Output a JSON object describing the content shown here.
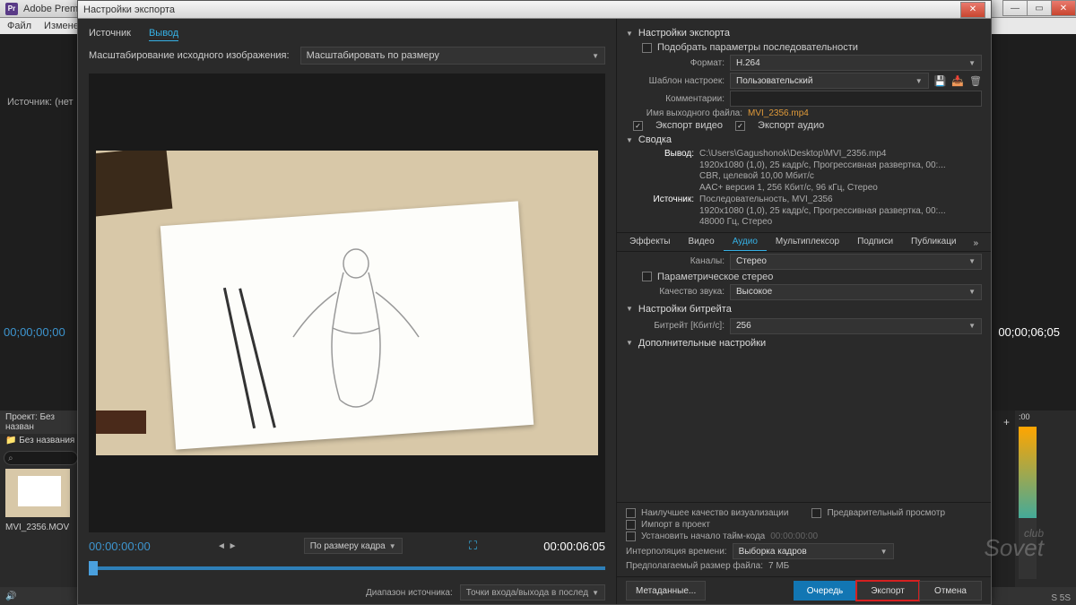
{
  "bg": {
    "app_title": "Adobe Premie",
    "menu": {
      "file": "Файл",
      "edit": "Измене"
    },
    "source_label": "Источник: (нет",
    "tc_left": "00;00;00;00",
    "tc_right": "00;00;06;05",
    "project_label": "Проект: Без назван",
    "bin_label": "Без названия",
    "clip_label": "MVI_2356.MOV",
    "speaker_icon": "🔊",
    "right_tc": ":00",
    "audio_scale": "S  5S",
    "plus": "+"
  },
  "dialog": {
    "title": "Настройки экспорта",
    "tabs": {
      "source": "Источник",
      "output": "Вывод"
    },
    "scale_label": "Масштабирование исходного изображения:",
    "scale_value": "Масштабировать по размеру",
    "tc_in": "00:00:00:00",
    "tc_out": "00:00:06:05",
    "fit_label": "По размеру кадра",
    "source_range_label": "Диапазон источника:",
    "source_range_value": "Точки входа/выхода в послед"
  },
  "settings": {
    "header": "Настройки экспорта",
    "match_seq": "Подобрать параметры последовательности",
    "format_label": "Формат:",
    "format_value": "H.264",
    "preset_label": "Шаблон настроек:",
    "preset_value": "Пользовательский",
    "comments_label": "Комментарии:",
    "outname_label": "Имя выходного файла:",
    "outname_value": "MVI_2356.mp4",
    "export_video": "Экспорт видео",
    "export_audio": "Экспорт аудио",
    "summary_header": "Сводка",
    "summary": {
      "output_label": "Вывод:",
      "output_lines": "C:\\Users\\Gagushonok\\Desktop\\MVI_2356.mp4\n1920x1080 (1,0), 25 кадр/с, Прогрессивная развертка, 00:...\nCBR, целевой 10,00 Мбит/с\nAAC+ версия 1, 256 Кбит/с, 96 кГц, Стерео",
      "source_label": "Источник:",
      "source_lines": "Последовательность, MVI_2356\n1920x1080 (1,0), 25 кадр/с, Прогрессивная развертка, 00:...\n48000 Гц, Стерео"
    },
    "tabs": {
      "effects": "Эффекты",
      "video": "Видео",
      "audio": "Аудио",
      "mux": "Мультиплексор",
      "captions": "Подписи",
      "publish": "Публикаци"
    },
    "channels_label": "Каналы:",
    "channels_value": "Стерео",
    "param_stereo": "Параметрическое стерео",
    "quality_label": "Качество звука:",
    "quality_value": "Высокое",
    "bitrate_header": "Настройки битрейта",
    "bitrate_label": "Битрейт [Кбит/с]:",
    "bitrate_value": "256",
    "advanced_header": "Дополнительные настройки"
  },
  "footer": {
    "best_quality": "Наилучшее качество визуализации",
    "preview": "Предварительный просмотр",
    "import_project": "Импорт в проект",
    "set_tc_start": "Установить начало тайм-кода",
    "tc_start_value": "00:00:00:00",
    "interp_label": "Интерполяция времени:",
    "interp_value": "Выборка кадров",
    "est_size_label": "Предполагаемый размер файла:",
    "est_size_value": "7 МБ",
    "buttons": {
      "metadata": "Метаданные...",
      "queue": "Очередь",
      "export": "Экспорт",
      "cancel": "Отмена"
    }
  },
  "watermark": {
    "small": "club",
    "big": "Sovet"
  }
}
